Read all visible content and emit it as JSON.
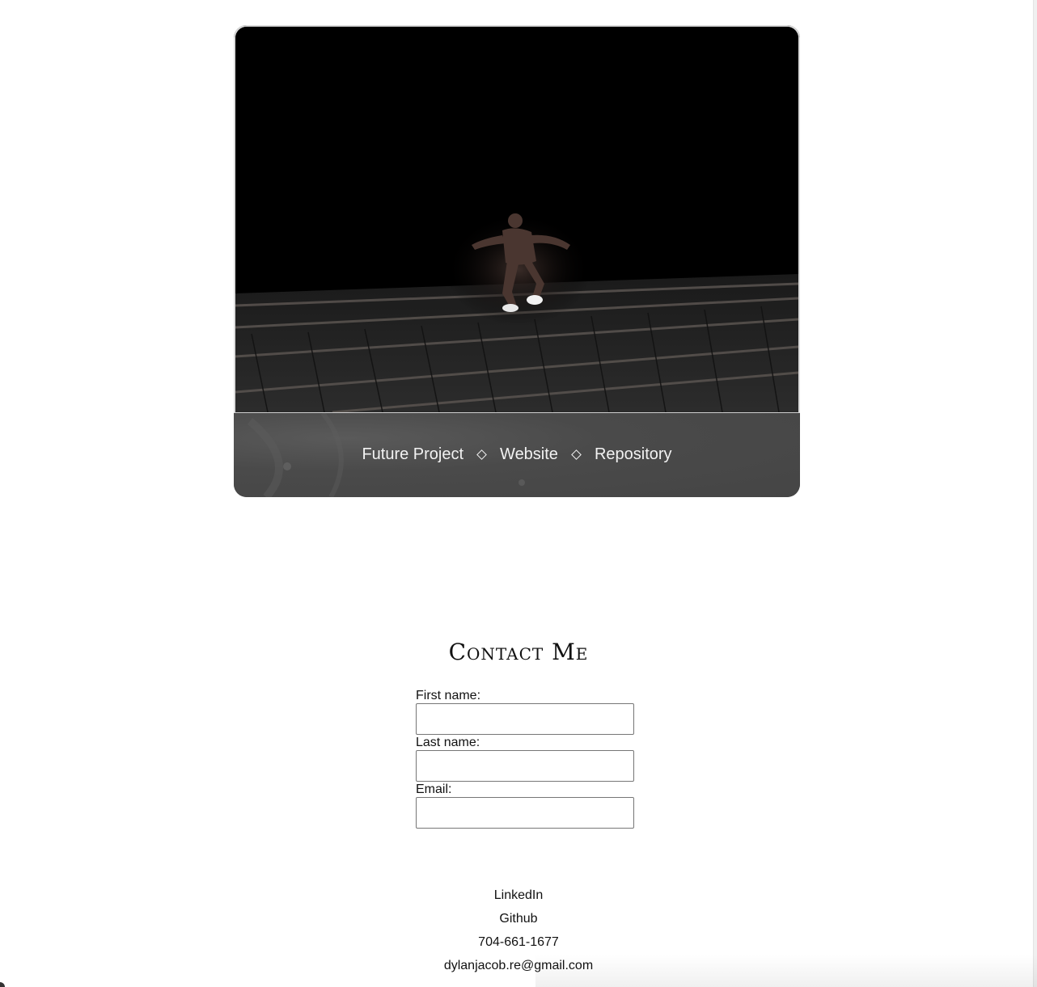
{
  "project": {
    "hero_image": "sprinter-on-boardwalk-photo",
    "links": [
      {
        "label": "Future Project"
      },
      {
        "label": "Website"
      },
      {
        "label": "Repository"
      }
    ],
    "separator_icon": "diamond-icon"
  },
  "contact": {
    "title": "Contact Me",
    "fields": {
      "first_name": {
        "label": "First name:",
        "value": ""
      },
      "last_name": {
        "label": "Last name:",
        "value": ""
      },
      "email": {
        "label": "Email:",
        "value": ""
      }
    },
    "links": {
      "linkedin": "LinkedIn",
      "github": "Github",
      "phone": "704-661-1677",
      "email": "dylanjacob.re@gmail.com"
    }
  },
  "colors": {
    "caption_bg": "#4a4a4a",
    "caption_text": "#f2f2f2",
    "page_bg": "#ffffff"
  }
}
